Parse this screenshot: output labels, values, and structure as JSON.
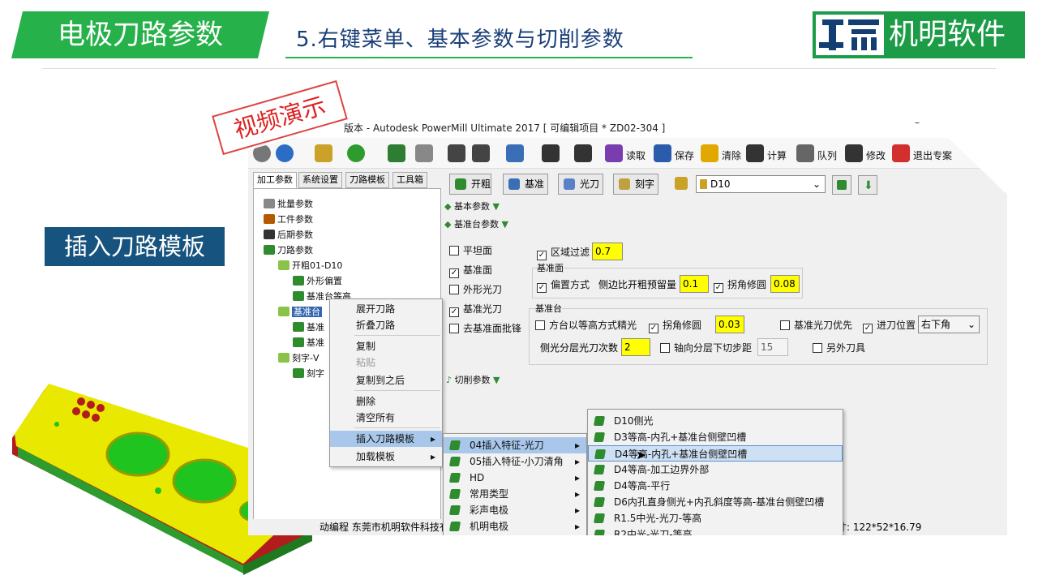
{
  "header": {
    "title": "电极刀路参数",
    "subtitle": "5.右键菜单、基本参数与切削参数",
    "logo_text": "机明软件"
  },
  "side_label": "插入刀路模板",
  "stamp": "视频演示",
  "app": {
    "title": "版本 - Autodesk PowerMill Ultimate 2017    [ 可编辑项目 * ZD02-304 ]",
    "minimize": "–",
    "toolbar": [
      {
        "label": "",
        "icon": "gear-icon",
        "color": "#777"
      },
      {
        "label": "",
        "icon": "globe-icon",
        "color": "#2b6cc4"
      },
      {
        "label": "",
        "icon": "part-icon",
        "color": "#c9a227"
      },
      {
        "label": "",
        "icon": "add-icon",
        "color": "#2e9b2e"
      },
      {
        "label": "",
        "icon": "excel-icon",
        "color": "#2e7d32"
      },
      {
        "label": "",
        "icon": "wrench-icon",
        "color": "#888"
      },
      {
        "label": "",
        "icon": "import-icon",
        "color": "#444"
      },
      {
        "label": "",
        "icon": "tree-icon",
        "color": "#444"
      },
      {
        "label": "",
        "icon": "folder-icon",
        "color": "#3a6fb5"
      },
      {
        "label": "",
        "icon": "first-icon",
        "color": "#333"
      },
      {
        "label": "",
        "icon": "last-icon",
        "color": "#333"
      },
      {
        "label": "读取",
        "icon": "read-icon",
        "color": "#7a3db0"
      },
      {
        "label": "保存",
        "icon": "save-icon",
        "color": "#2b5cab"
      },
      {
        "label": "清除",
        "icon": "clear-icon",
        "color": "#e0a800"
      },
      {
        "label": "计算",
        "icon": "calc-icon",
        "color": "#333"
      },
      {
        "label": "队列",
        "icon": "queue-icon",
        "color": "#666"
      },
      {
        "label": "修改",
        "icon": "modify-icon",
        "color": "#333"
      },
      {
        "label": "退出专案",
        "icon": "exit-icon",
        "color": "#d32f2f"
      }
    ],
    "tabs": [
      "加工参数",
      "系统设置",
      "刀路模板",
      "工具箱"
    ],
    "tree": [
      {
        "label": "批量参数",
        "indent": 0,
        "color": "#888"
      },
      {
        "label": "工件参数",
        "indent": 0,
        "color": "#b35a00"
      },
      {
        "label": "后期参数",
        "indent": 0,
        "color": "#333"
      },
      {
        "label": "刀路参数",
        "indent": 0,
        "color": "#2e8b2e"
      },
      {
        "label": "开粗01-D10",
        "indent": 1,
        "color": "#8bc34a"
      },
      {
        "label": "外形偏置",
        "indent": 2,
        "color": "#2e8b2e"
      },
      {
        "label": "基准台等高",
        "indent": 2,
        "color": "#2e8b2e"
      },
      {
        "label": "基准台",
        "indent": 1,
        "color": "#8bc34a"
      },
      {
        "label": "基准",
        "indent": 2,
        "color": "#2e8b2e"
      },
      {
        "label": "基准",
        "indent": 2,
        "color": "#2e8b2e"
      },
      {
        "label": "刻字-V",
        "indent": 1,
        "color": "#8bc34a"
      },
      {
        "label": "刻字",
        "indent": 2,
        "color": "#2e8b2e"
      }
    ],
    "panel": {
      "buttons": [
        "开粗",
        "基准",
        "光刀",
        "刻字"
      ],
      "tool": "D10",
      "sections": {
        "basic": "基本参数",
        "base_platform": "基准台参数",
        "cutting": "切削参数"
      },
      "left_checks": [
        {
          "label": "平坦面",
          "checked": false
        },
        {
          "label": "基准面",
          "checked": true
        },
        {
          "label": "外形光刀",
          "checked": false
        },
        {
          "label": "基准光刀",
          "checked": true
        },
        {
          "label": "去基准面批锋",
          "checked": false
        }
      ],
      "region_filter": {
        "label": "区域过滤",
        "checked": true,
        "value": "0.7"
      },
      "base_face": {
        "group": "基准面",
        "offset_label": "偏置方式",
        "offset_checked": true,
        "side_label": "侧边比开粗预留量",
        "side_value": "0.1",
        "corner_label": "拐角修圆",
        "corner_checked": true,
        "corner_value": "0.08"
      },
      "base_table": {
        "group": "基准台",
        "square_label": "方台以等高方式精光",
        "square_checked": false,
        "corner_label": "拐角修圆",
        "corner_checked": true,
        "corner_value": "0.03",
        "prio_label": "基准光刀优先",
        "prio_checked": false,
        "entry_label": "进刀位置",
        "entry_checked": true,
        "entry_value": "右下角",
        "layers_label": "侧光分层光刀次数",
        "layers_value": "2",
        "axial_label": "轴向分层下切步距",
        "axial_checked": false,
        "axial_value": "15",
        "other_label": "另外刀具",
        "other_checked": false
      }
    },
    "status_left": "动编程  东莞市机明软件科技有",
    "status_right": "寸:  122*52*16.79"
  },
  "context_menu": {
    "items": [
      "展开刀路",
      "折叠刀路",
      "复制",
      "粘贴",
      "复制到之后",
      "删除",
      "清空所有",
      "插入刀路模板",
      "加载模板"
    ]
  },
  "submenu1": {
    "items": [
      "04插入特征-光刀",
      "05插入特征-小刀清角",
      "HD",
      "常用类型",
      "彩声电极",
      "机明电极"
    ]
  },
  "submenu2": {
    "items": [
      "D10侧光",
      "D3等高-内孔+基准台侧壁凹槽",
      "D4等高-内孔+基准台侧壁凹槽",
      "D4等高-加工边界外部",
      "D4等高-平行",
      "D6内孔直身侧光+内孔斜度等高-基准台侧壁凹槽",
      "R1.5中光-光刀-等高",
      "R2中光-光刀-等高"
    ]
  }
}
